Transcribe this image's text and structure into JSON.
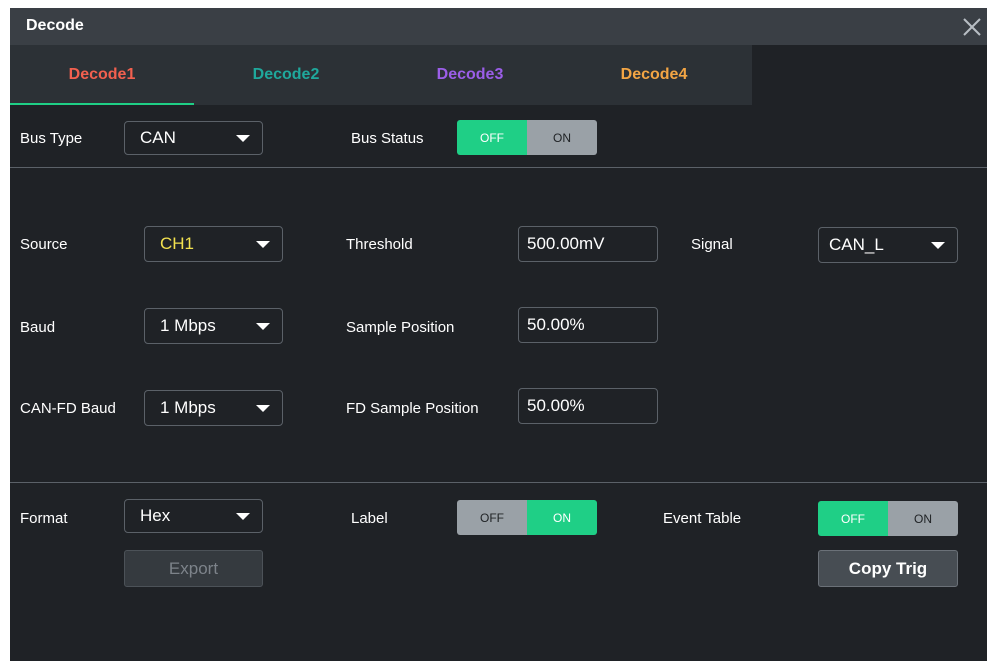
{
  "dialog": {
    "title": "Decode"
  },
  "tabs": [
    {
      "label": "Decode1",
      "color": "#f2604f",
      "active": true
    },
    {
      "label": "Decode2",
      "color": "#1fa89c"
    },
    {
      "label": "Decode3",
      "color": "#9b5ee8"
    },
    {
      "label": "Decode4",
      "color": "#f3a544"
    }
  ],
  "bus": {
    "type_label": "Bus Type",
    "type_value": "CAN",
    "status_label": "Bus Status",
    "status_off": "OFF",
    "status_on": "ON",
    "status_state": "OFF"
  },
  "settings": {
    "source_label": "Source",
    "source_value": "CH1",
    "source_color": "#f2e14f",
    "threshold_label": "Threshold",
    "threshold_value": "500.00mV",
    "signal_label": "Signal",
    "signal_value": "CAN_L",
    "baud_label": "Baud",
    "baud_value": "1 Mbps",
    "sample_position_label": "Sample Position",
    "sample_position_value": "50.00%",
    "canfd_baud_label": "CAN-FD Baud",
    "canfd_baud_value": "1 Mbps",
    "fd_sample_position_label": "FD Sample Position",
    "fd_sample_position_value": "50.00%"
  },
  "display": {
    "format_label": "Format",
    "format_value": "Hex",
    "label_label": "Label",
    "label_off": "OFF",
    "label_on": "ON",
    "label_state": "ON",
    "event_table_label": "Event Table",
    "event_table_off": "OFF",
    "event_table_on": "ON",
    "event_table_state": "OFF",
    "export_label": "Export",
    "copy_trig_label": "Copy Trig"
  },
  "icons": {
    "close": "close-icon",
    "dropdown": "caret-down-icon"
  },
  "colors": {
    "accent": "#1fcf86",
    "background": "#1f2226"
  }
}
